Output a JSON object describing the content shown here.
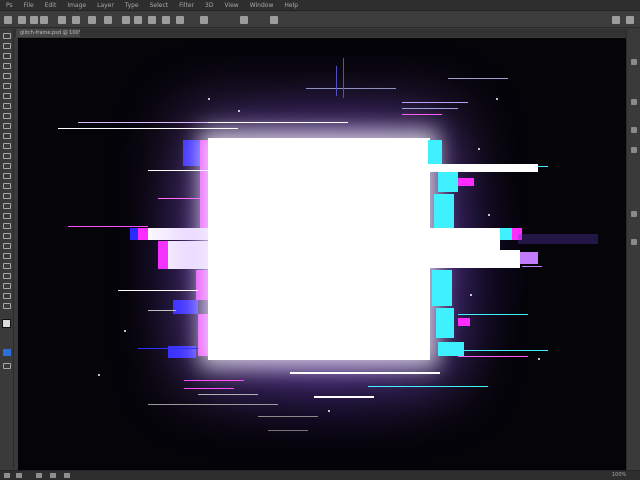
{
  "menubar": {
    "items": [
      "Ps",
      "File",
      "Edit",
      "Image",
      "Layer",
      "Type",
      "Select",
      "Filter",
      "3D",
      "View",
      "Window",
      "Help"
    ]
  },
  "document": {
    "tab_title": "glitch-frame.psd @ 100%"
  },
  "status": {
    "zoom": "100%"
  },
  "canvas_art": {
    "description_colors": {
      "core": "#ffffff",
      "magenta": "#ff2bff",
      "cyan": "#3ff0ff",
      "blue": "#2a2aff",
      "glow": "#8c50ff"
    }
  }
}
